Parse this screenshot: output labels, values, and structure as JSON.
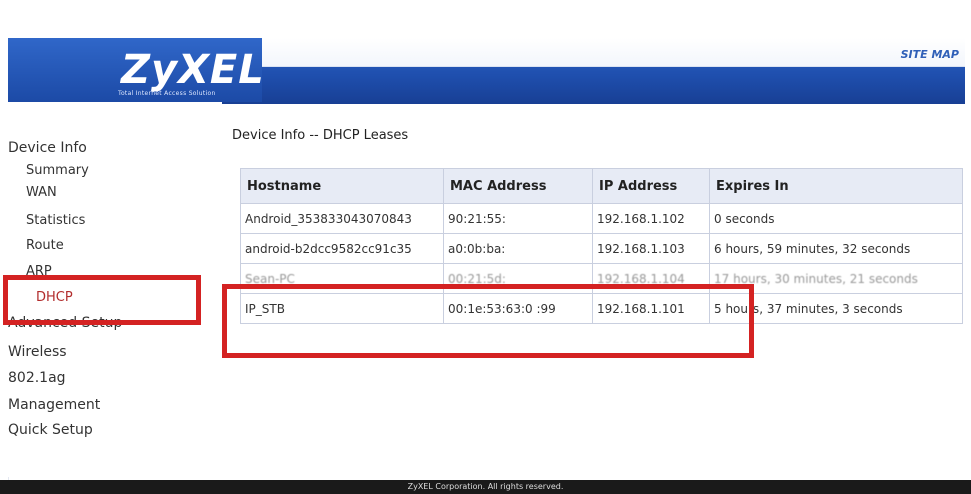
{
  "header": {
    "logo": "ZyXEL",
    "tagline": "Total Internet Access Solution",
    "site_map": "SITE MAP"
  },
  "sidebar": {
    "items": [
      {
        "label": "Device Info",
        "sub": false
      },
      {
        "label": "Summary",
        "sub": true
      },
      {
        "label": "WAN",
        "sub": true
      },
      {
        "label": "Statistics",
        "sub": true
      },
      {
        "label": "Route",
        "sub": true
      },
      {
        "label": "ARP",
        "sub": true
      },
      {
        "label": "DHCP",
        "sub": true,
        "active": true
      },
      {
        "label": "Advanced Setup",
        "sub": false
      },
      {
        "label": "Wireless",
        "sub": false
      },
      {
        "label": "802.1ag",
        "sub": false
      },
      {
        "label": "Management",
        "sub": false
      },
      {
        "label": "Quick Setup",
        "sub": false
      }
    ]
  },
  "main": {
    "title": "Device Info -- DHCP Leases",
    "columns": [
      "Hostname",
      "MAC Address",
      "IP Address",
      "Expires In"
    ],
    "rows": [
      {
        "hostname": "Android_353833043070843",
        "mac": "90:21:55:",
        "ip": "192.168.1.102",
        "expires": "0 seconds"
      },
      {
        "hostname": "android-b2dcc9582cc91c35",
        "mac": "a0:0b:ba:",
        "ip": "192.168.1.103",
        "expires": "6 hours, 59 minutes, 32 seconds"
      },
      {
        "hostname": "Sean-PC",
        "mac": "00:21:5d:",
        "ip": "192.168.1.104",
        "expires": "17 hours, 30 minutes, 21 seconds"
      },
      {
        "hostname": "IP_STB",
        "mac": "00:1e:53:63:0 :99",
        "ip": "192.168.1.101",
        "expires": "5 hours, 37 minutes, 3 seconds"
      }
    ]
  },
  "footer": {
    "text": "ZyXEL Corporation. All rights reserved."
  }
}
